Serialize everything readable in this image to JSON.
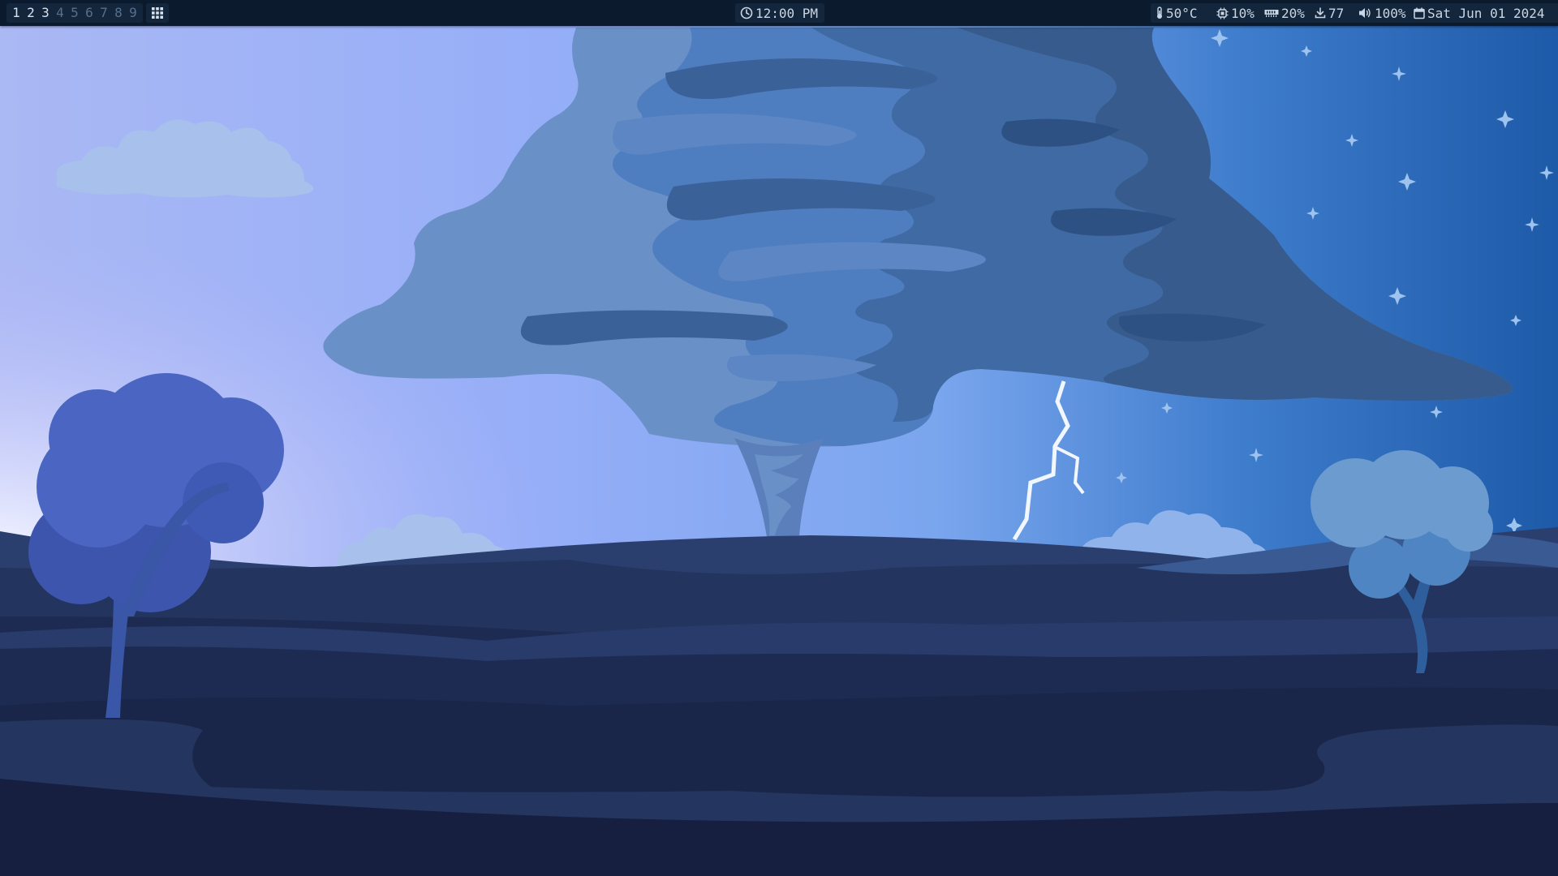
{
  "workspaces": [
    {
      "label": "1",
      "active": true
    },
    {
      "label": "2",
      "active": true
    },
    {
      "label": "3",
      "active": true
    },
    {
      "label": "4",
      "active": false
    },
    {
      "label": "5",
      "active": false
    },
    {
      "label": "6",
      "active": false
    },
    {
      "label": "7",
      "active": false
    },
    {
      "label": "8",
      "active": false
    },
    {
      "label": "9",
      "active": false
    }
  ],
  "launcher": {
    "icon": "grid-icon"
  },
  "clock": {
    "icon": "clock-icon",
    "text": "12:00 PM"
  },
  "status": {
    "temperature": {
      "icon": "thermometer-icon",
      "text": "50°C"
    },
    "cpu": {
      "icon": "cpu-icon",
      "text": "10%"
    },
    "memory": {
      "icon": "memory-icon",
      "text": "20%"
    },
    "downloads": {
      "icon": "download-icon",
      "text": "77"
    },
    "volume": {
      "icon": "speaker-icon",
      "text": "100%"
    },
    "date": {
      "icon": "calendar-icon",
      "text": "Sat Jun 01 2024"
    }
  },
  "colors": {
    "bar_background": "#0b1a2c",
    "pill_background": "#14263b",
    "text": "#c9d6e6",
    "inactive_workspace": "#56708d"
  }
}
